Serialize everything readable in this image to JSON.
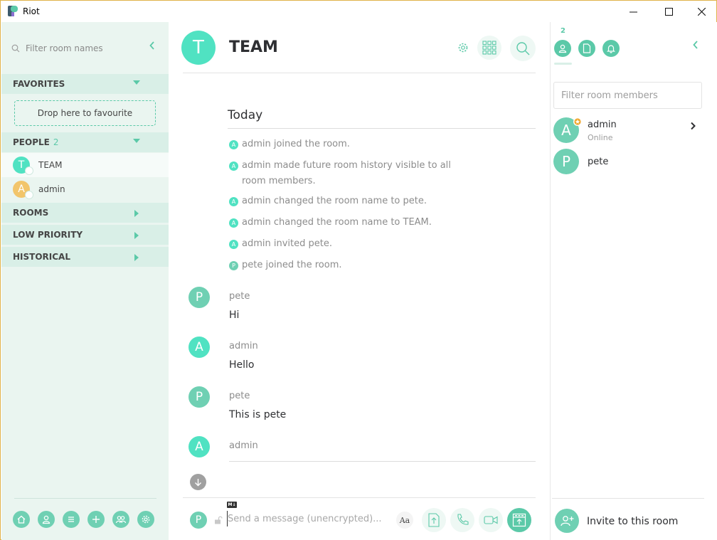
{
  "window": {
    "title": "Riot",
    "min_glyph": "—",
    "max_glyph": "☐",
    "close_glyph": "✕"
  },
  "colors": {
    "accent": "#5bc9a8",
    "avatar_teal": "#50e2c2",
    "avatar_green": "#6fd0b3",
    "avatar_orange": "#f2c56b",
    "panel_bg": "#eaf5f0"
  },
  "left_panel": {
    "filter_placeholder": "Filter room names",
    "collapse_glyph": "‹",
    "sections": {
      "favorites": {
        "label": "FAVORITES"
      },
      "people": {
        "label": "PEOPLE",
        "count": "2"
      },
      "rooms": {
        "label": "ROOMS"
      },
      "low_priority": {
        "label": "LOW PRIORITY"
      },
      "historical": {
        "label": "HISTORICAL"
      }
    },
    "dropzone_label": "Drop here to favourite",
    "people": [
      {
        "initial": "T",
        "name": "TEAM"
      },
      {
        "initial": "A",
        "name": "admin"
      }
    ],
    "footer_icons": [
      "home-icon",
      "user-icon",
      "room-directory-icon",
      "create-room-icon",
      "groups-icon",
      "settings-icon"
    ]
  },
  "room": {
    "initial": "T",
    "name": "TEAM"
  },
  "timeline": {
    "date_separator": "Today",
    "events": [
      {
        "initial": "A",
        "text": "admin joined the room."
      },
      {
        "initial": "A",
        "text": "admin made future room history visible to all",
        "text2": "room members."
      },
      {
        "initial": "A",
        "text": "admin changed the room name to pete."
      },
      {
        "initial": "A",
        "text": "admin changed the room name to TEAM."
      },
      {
        "initial": "A",
        "text": "admin invited pete."
      },
      {
        "initial": "P",
        "text": "pete joined the room."
      }
    ],
    "messages": [
      {
        "initial": "P",
        "sender": "pete",
        "body": "Hi"
      },
      {
        "initial": "A",
        "sender": "admin",
        "body": "Hello"
      },
      {
        "initial": "P",
        "sender": "pete",
        "body": "This is pete"
      },
      {
        "initial": "A",
        "sender": "admin",
        "body": ""
      }
    ]
  },
  "composer": {
    "markdown_badge": "M↓",
    "user_initial": "P",
    "placeholder": "Send a message (unencrypted)...",
    "format_label": "Aa"
  },
  "right_panel": {
    "member_count": "2",
    "collapse_glyph": "‹",
    "filter_placeholder": "Filter room members",
    "members": [
      {
        "initial": "A",
        "name": "admin",
        "status": "Online"
      },
      {
        "initial": "P",
        "name": "pete",
        "status": ""
      }
    ],
    "invite_label": "Invite to this room"
  }
}
